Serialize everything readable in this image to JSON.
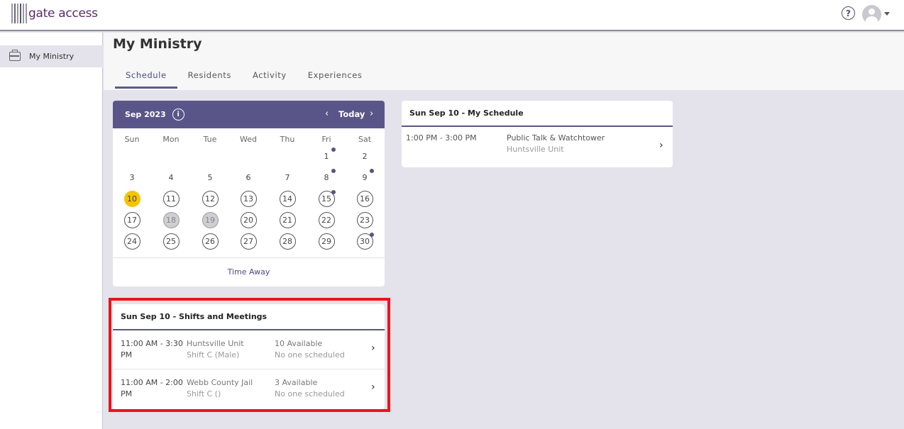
{
  "brand": {
    "logo_text": "gate access"
  },
  "header": {
    "help_icon": "question-circle-icon",
    "avatar_icon": "user-avatar-icon"
  },
  "sidebar": {
    "items": [
      {
        "label": "My Ministry",
        "icon": "briefcase-icon"
      }
    ]
  },
  "page": {
    "title": "My Ministry",
    "tabs": [
      {
        "label": "Schedule",
        "active": true
      },
      {
        "label": "Residents",
        "active": false
      },
      {
        "label": "Activity",
        "active": false
      },
      {
        "label": "Experiences",
        "active": false
      }
    ]
  },
  "calendar": {
    "month_label": "Sep 2023",
    "today_label": "Today",
    "days_of_week": [
      "Sun",
      "Mon",
      "Tue",
      "Wed",
      "Thu",
      "Fri",
      "Sat"
    ],
    "weeks": [
      [
        "",
        "",
        "",
        "",
        "",
        "1",
        "2"
      ],
      [
        "3",
        "4",
        "5",
        "6",
        "7",
        "8",
        "9"
      ],
      [
        "10",
        "11",
        "12",
        "13",
        "14",
        "15",
        "16"
      ],
      [
        "17",
        "18",
        "19",
        "20",
        "21",
        "22",
        "23"
      ],
      [
        "24",
        "25",
        "26",
        "27",
        "28",
        "29",
        "30"
      ]
    ],
    "selected_day": "10",
    "greyed_days": [
      "18",
      "19"
    ],
    "days_with_events": [
      "1",
      "8",
      "9",
      "15",
      "30"
    ],
    "time_away_label": "Time Away",
    "colors": {
      "header": "#5a5588",
      "today": "#f5c400",
      "event_dot": "#58547e"
    }
  },
  "my_schedule": {
    "title": "Sun Sep 10 - My Schedule",
    "items": [
      {
        "time": "1:00 PM - 3:00 PM",
        "name": "Public Talk & Watchtower",
        "location": "Huntsville Unit"
      }
    ]
  },
  "shifts_meetings": {
    "title": "Sun Sep 10 - Shifts and Meetings",
    "highlight_color": "#e8151c",
    "items": [
      {
        "time_line1": "11:00 AM - 3:30",
        "time_line2": "PM",
        "unit": "Huntsville Unit",
        "shift": "Shift C (Male)",
        "available": "10 Available",
        "scheduled": "No one scheduled"
      },
      {
        "time_line1": "11:00 AM - 2:00",
        "time_line2": "PM",
        "unit": "Webb County Jail",
        "shift": "Shift C ()",
        "available": "3 Available",
        "scheduled": "No one scheduled"
      }
    ]
  }
}
